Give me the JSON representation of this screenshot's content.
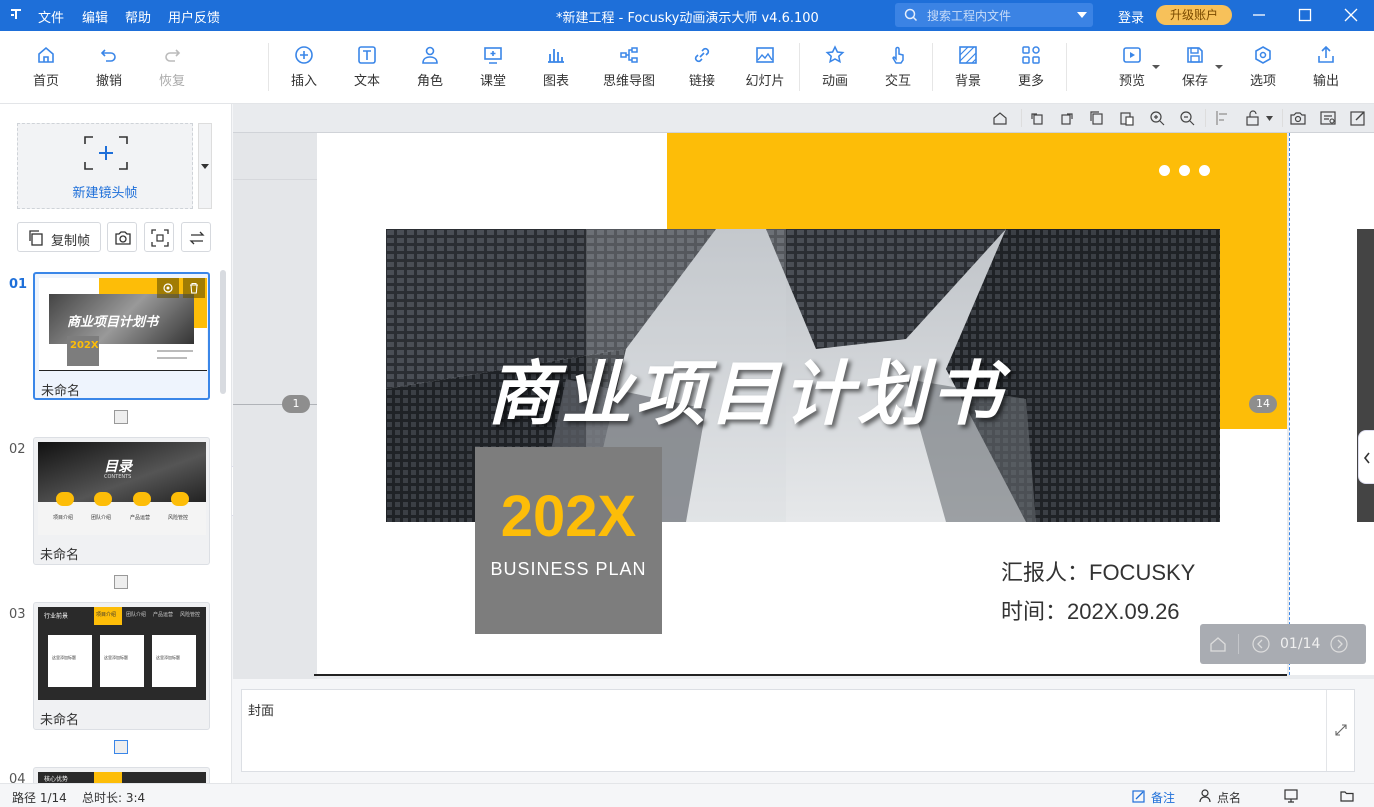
{
  "titlebar": {
    "menu": [
      "文件",
      "编辑",
      "帮助",
      "用户反馈"
    ],
    "window_title": "*新建工程 - Focusky动画演示大师  v4.6.100",
    "search_placeholder": "搜索工程内文件",
    "login": "登录",
    "upgrade": "升级账户"
  },
  "toolbar": {
    "home": "首页",
    "undo": "撤销",
    "redo": "恢复",
    "insert": "插入",
    "text": "文本",
    "role": "角色",
    "classroom": "课堂",
    "chart": "图表",
    "mindmap": "思维导图",
    "link": "链接",
    "slideshow": "幻灯片",
    "animation": "动画",
    "interaction": "交互",
    "background": "背景",
    "more": "更多",
    "preview": "预览",
    "save": "保存",
    "options": "选项",
    "export": "输出"
  },
  "left_panel": {
    "new_frame": "新建镜头帧",
    "copy_frame": "复制帧",
    "slides": [
      {
        "num": "01",
        "name": "未命名",
        "thumb_title": "商业项目计划书",
        "thumb_year": "202X"
      },
      {
        "num": "02",
        "name": "未命名",
        "thumb_title": "目录",
        "thumb_sub": "CONTENTS",
        "thumb_items": [
          "项目介绍",
          "团队介绍",
          "产品运营",
          "风险管控"
        ]
      },
      {
        "num": "03",
        "name": "未命名",
        "thumb_title": "行业前景",
        "thumb_tabs": [
          "项目介绍",
          "团队介绍",
          "产品运营",
          "风险管控"
        ],
        "thumb_cards": [
          "这里添加标题",
          "这里添加标题",
          "这里添加标题"
        ]
      },
      {
        "num": "04",
        "name": "",
        "thumb_title": "核心优势"
      }
    ]
  },
  "slide": {
    "title": "商业项目计划书",
    "year": "202X",
    "subtitle": "BUSINESS PLAN",
    "reporter": "汇报人：FOCUSKY",
    "date": "时间：202X.09.26",
    "path_start": "1",
    "path_end": "14"
  },
  "nav": {
    "page": "01/14"
  },
  "notes": {
    "text": "封面"
  },
  "status": {
    "path": "路径 1/14",
    "duration": "总时长: 3:4",
    "notes_btn": "备注",
    "rollcall_btn": "点名"
  },
  "colors": {
    "accent": "#1e6fd9",
    "yellow": "#fdbd08",
    "gray_box": "#7d7d7d"
  }
}
